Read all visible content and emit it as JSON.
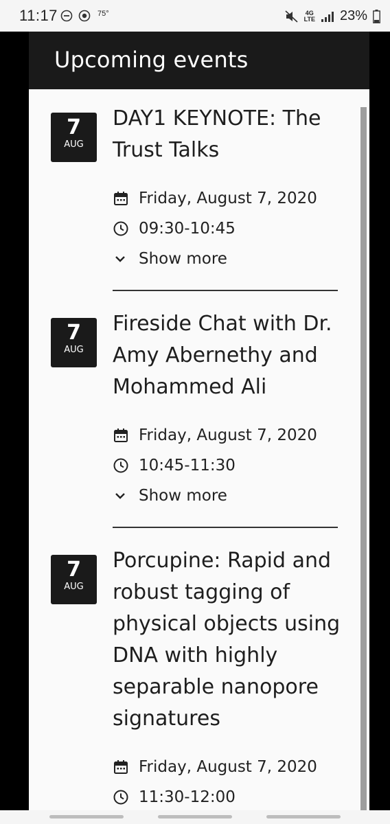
{
  "status_bar": {
    "time": "11:17",
    "temperature": "75°",
    "network": "4G",
    "network_sub": "LTE",
    "battery": "23%"
  },
  "header": {
    "title": "Upcoming events"
  },
  "events": [
    {
      "day": "7",
      "month": "AUG",
      "title_lines": [
        "DAY1 KEYNOTE: The",
        "Trust Talks"
      ],
      "date": "Friday, August 7, 2020",
      "time": "09:30-10:45",
      "show_more": "Show more"
    },
    {
      "day": "7",
      "month": "AUG",
      "title_lines": [
        "Fireside Chat with Dr.",
        "Amy Abernethy and",
        "Mohammed Ali"
      ],
      "date": "Friday, August 7, 2020",
      "time": "10:45-11:30",
      "show_more": "Show more"
    },
    {
      "day": "7",
      "month": "AUG",
      "title_lines": [
        "Porcupine: Rapid and",
        "robust tagging of",
        "physical objects using",
        "DNA with highly",
        "separable nanopore",
        "signatures"
      ],
      "date": "Friday, August 7, 2020",
      "time": "11:30-12:00"
    }
  ],
  "icons": {
    "calendar": "calendar-icon",
    "clock": "clock-icon",
    "chevron": "chevron-down-icon"
  }
}
